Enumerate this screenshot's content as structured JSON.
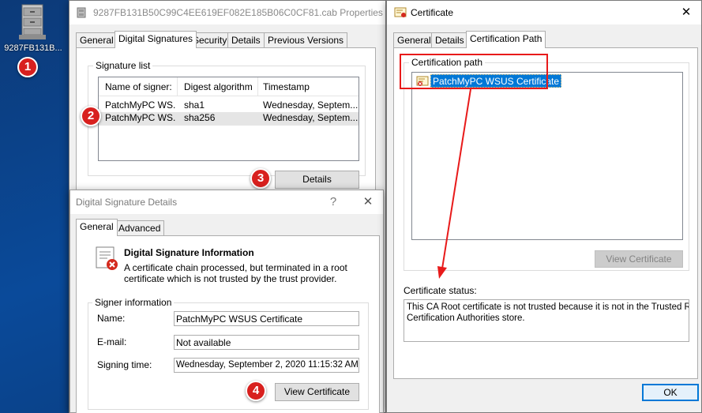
{
  "desktop": {
    "icon_label": "9287FB131B...",
    "badge1": "1"
  },
  "badges": {
    "b2": "2",
    "b3": "3",
    "b4": "4"
  },
  "properties": {
    "title": "9287FB131B50C99C4EE619EF082E185B06C0CF81.cab Properties",
    "tabs": [
      "General",
      "Digital Signatures",
      "Security",
      "Details",
      "Previous Versions"
    ],
    "signature_list_label": "Signature list",
    "columns": [
      "Name of signer:",
      "Digest algorithm",
      "Timestamp"
    ],
    "rows": [
      [
        "PatchMyPC WS...",
        "sha1",
        "Wednesday, Septem..."
      ],
      [
        "PatchMyPC WS...",
        "sha256",
        "Wednesday, Septem..."
      ]
    ],
    "details_button": "Details"
  },
  "details_dialog": {
    "title": "Digital Signature Details",
    "help": "?",
    "close": "✕",
    "tabs": [
      "General",
      "Advanced"
    ],
    "info_title": "Digital Signature Information",
    "info_text_1": "A certificate chain processed, but terminated in a root",
    "info_text_2": "certificate which is not trusted by the trust provider.",
    "signer_group_label": "Signer information",
    "name_label": "Name:",
    "name_value": "PatchMyPC WSUS Certificate",
    "email_label": "E-mail:",
    "email_value": "Not available",
    "signing_time_label": "Signing time:",
    "signing_time_value": "Wednesday, September 2, 2020 11:15:32 AM",
    "view_certificate_button": "View Certificate"
  },
  "certificate": {
    "title": "Certificate",
    "close": "✕",
    "tabs": [
      "General",
      "Details",
      "Certification Path"
    ],
    "path_group_label": "Certification path",
    "path_item": "PatchMyPC WSUS Certificate",
    "view_certificate_button": "View Certificate",
    "status_label": "Certificate status:",
    "status_text_1": "This CA Root certificate is not trusted because it is not in the Trusted Root",
    "status_text_2": "Certification Authorities store.",
    "ok_button": "OK"
  },
  "colors": {
    "accent_red": "#e81a1a",
    "badge_red": "#d8201e",
    "selection_blue": "#0078d7",
    "desktop_blue": "#0a4a9a"
  }
}
